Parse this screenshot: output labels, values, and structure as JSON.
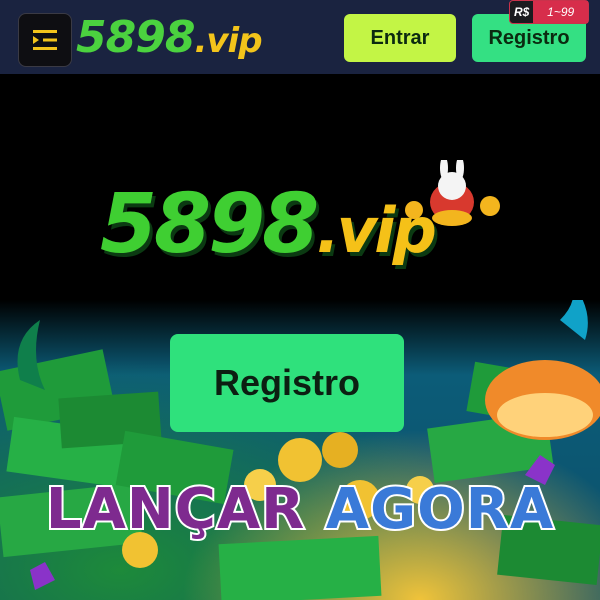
{
  "header": {
    "brand_number": "5898",
    "brand_tld": ".vip",
    "login_label": "Entrar",
    "register_label": "Registro",
    "badge_currency": "R$",
    "badge_range": "1~99"
  },
  "hero": {
    "brand_number": "5898",
    "brand_tld": ".vip",
    "cta_label": "Registro",
    "launch_word1": "LANÇAR",
    "launch_word2": "AGORA"
  },
  "icons": {
    "menu": "menu-icon",
    "mascot": "rabbit-mascot-icon"
  },
  "colors": {
    "header_bg": "#1a2340",
    "brand_green": "#3fcf32",
    "brand_gold": "#f5c118",
    "entrar_btn": "#c3f545",
    "registro_btn": "#34e083",
    "badge_red": "#d72d4b"
  }
}
